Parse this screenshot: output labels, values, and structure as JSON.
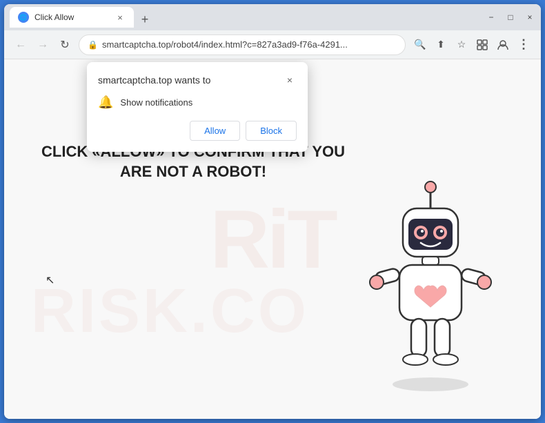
{
  "browser": {
    "title": "Click Allow",
    "tab": {
      "title": "Click Allow",
      "favicon_label": "🌐"
    },
    "new_tab_label": "+",
    "address": {
      "url": "smartcaptcha.top/robot4/index.html?c=827a3ad9-f76a-4291...",
      "lock_icon": "🔒"
    },
    "nav": {
      "back_label": "←",
      "forward_label": "→",
      "refresh_label": "↻"
    },
    "toolbar": {
      "search_icon": "🔍",
      "share_icon": "⬆",
      "bookmark_icon": "☆",
      "ext_icon": "□",
      "profile_icon": "👤",
      "menu_icon": "⋮"
    },
    "window_controls": {
      "minimize": "−",
      "maximize": "□",
      "close": "×"
    }
  },
  "popup": {
    "title": "smartcaptcha.top wants to",
    "close_label": "×",
    "notification_text": "Show notifications",
    "allow_label": "Allow",
    "block_label": "Block"
  },
  "page": {
    "main_text": "CLICK «ALLOW» TO CONFIRM THAT YOU ARE NOT A ROBOT!",
    "watermark_text": "RiT",
    "watermark_bottom": "RISK.CO"
  }
}
